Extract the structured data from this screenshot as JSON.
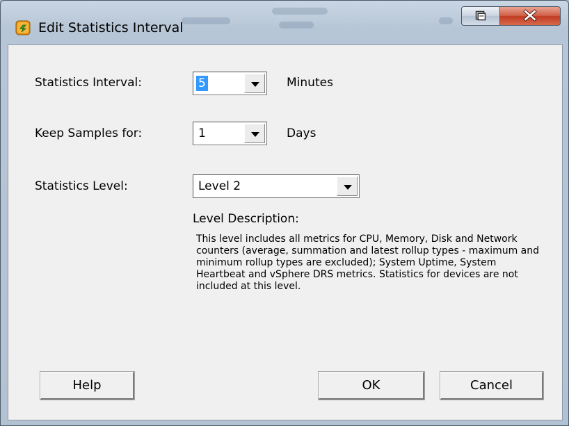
{
  "window": {
    "title": "Edit Statistics Interval",
    "icons": {
      "app": "vsphere-icon",
      "restore": "restore-icon",
      "close": "close-icon"
    },
    "colors": {
      "close_button": "#c9432a",
      "selection": "#3399ff"
    }
  },
  "form": {
    "interval": {
      "label": "Statistics Interval:",
      "value": "5",
      "unit": "Minutes"
    },
    "keep_samples": {
      "label": "Keep Samples for:",
      "value": "1",
      "unit": "Days"
    },
    "level": {
      "label": "Statistics Level:",
      "value": "Level 2"
    },
    "level_description": {
      "heading": "Level Description:",
      "text": "This level includes all metrics for CPU, Memory, Disk and Network counters (average, summation and latest rollup types - maximum and minimum rollup types are excluded); System Uptime, System Heartbeat and vSphere DRS metrics. Statistics for devices are not included at this level."
    }
  },
  "buttons": {
    "help": "Help",
    "ok": "OK",
    "cancel": "Cancel"
  }
}
